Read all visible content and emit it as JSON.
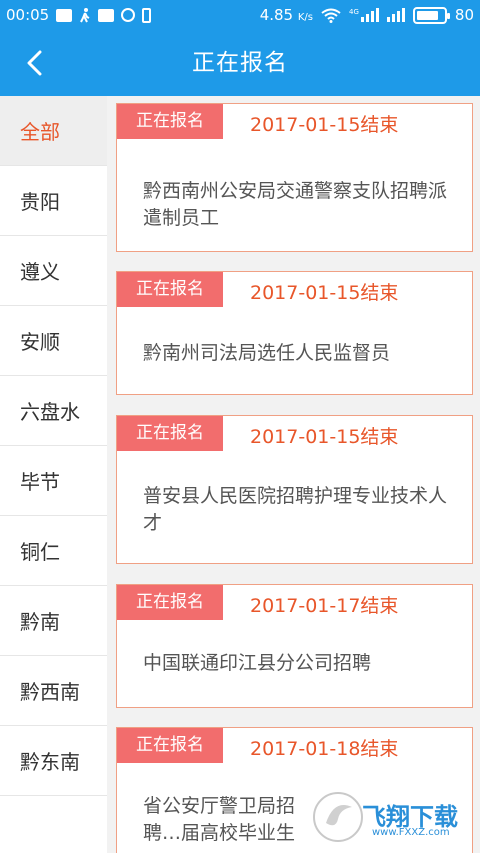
{
  "status_bar": {
    "time": "00:05",
    "speed": "4.85",
    "speed_unit": "K/s",
    "battery": "80",
    "network": "4G"
  },
  "header": {
    "title": "正在报名"
  },
  "sidebar": {
    "items": [
      {
        "label": "全部",
        "active": true
      },
      {
        "label": "贵阳"
      },
      {
        "label": "遵义"
      },
      {
        "label": "安顺"
      },
      {
        "label": "六盘水"
      },
      {
        "label": "毕节"
      },
      {
        "label": "铜仁"
      },
      {
        "label": "黔南"
      },
      {
        "label": "黔西南"
      },
      {
        "label": "黔东南"
      }
    ]
  },
  "cards": [
    {
      "tag": "正在报名",
      "date": "2017-01-15结束",
      "title": "黔西南州公安局交通警察支队招聘派遣制员工"
    },
    {
      "tag": "正在报名",
      "date": "2017-01-15结束",
      "title": "黔南州司法局选任人民监督员"
    },
    {
      "tag": "正在报名",
      "date": "2017-01-15结束",
      "title": "普安县人民医院招聘护理专业技术人才"
    },
    {
      "tag": "正在报名",
      "date": "2017-01-17结束",
      "title": "中国联通印江县分公司招聘"
    },
    {
      "tag": "正在报名",
      "date": "2017-01-18结束",
      "title": "省公安厅警卫局招聘…届高校毕业生"
    }
  ],
  "watermark": {
    "text": "飞翔下载",
    "url": "www.FXXZ.com"
  },
  "colors": {
    "primary": "#1e9ae8",
    "accent": "#e8562a",
    "tag": "#f26d6d",
    "card_border": "#f0a084"
  }
}
